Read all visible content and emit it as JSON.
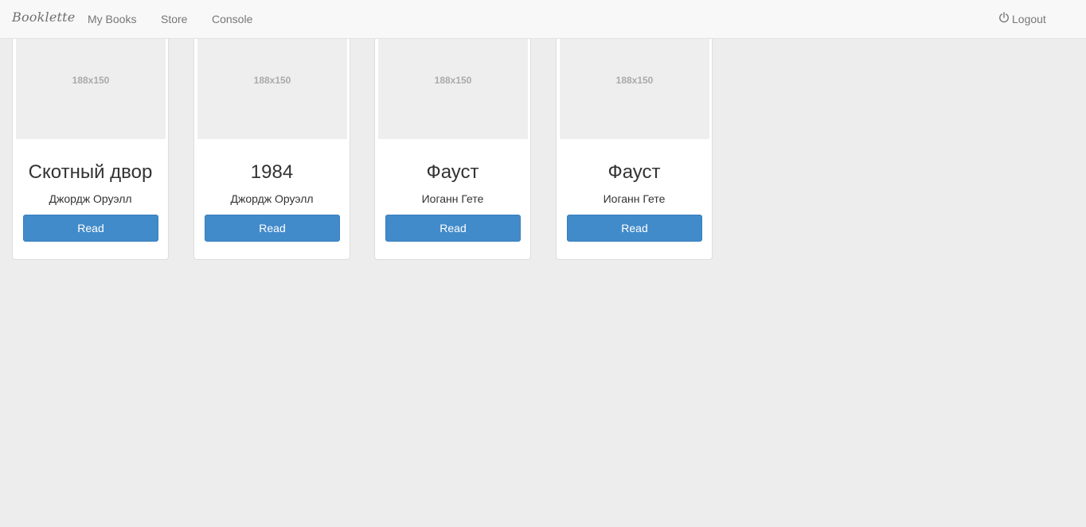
{
  "navbar": {
    "brand": "Booklette",
    "links": [
      "My Books",
      "Store",
      "Console"
    ],
    "logout_label": "Logout",
    "logout_icon": "power-icon"
  },
  "books": [
    {
      "thumb_label": "188x150",
      "title": "Скотный двор",
      "author": "Джордж Оруэлл",
      "button": "Read"
    },
    {
      "thumb_label": "188x150",
      "title": "1984",
      "author": "Джордж Оруэлл",
      "button": "Read"
    },
    {
      "thumb_label": "188x150",
      "title": "Фауст",
      "author": "Иоганн Гете",
      "button": "Read"
    },
    {
      "thumb_label": "188x150",
      "title": "Фауст",
      "author": "Иоганн Гете",
      "button": "Read"
    }
  ],
  "colors": {
    "primary_button": "#428bca",
    "page_background": "#ededed",
    "navbar_background": "#f8f8f8"
  }
}
